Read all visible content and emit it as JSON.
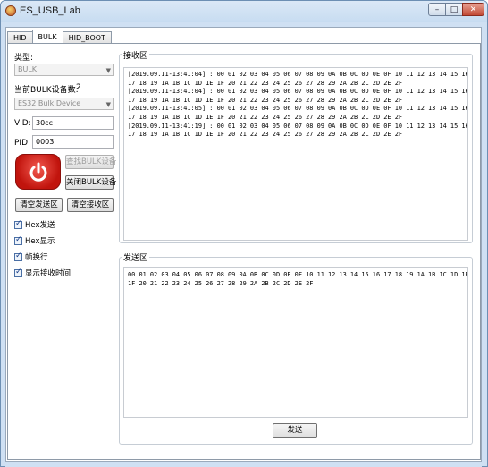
{
  "window": {
    "title": "ES_USB_Lab",
    "controls": {
      "minimize": "–",
      "maximize": "□",
      "close": "✕"
    }
  },
  "tabs": [
    {
      "label": "HID"
    },
    {
      "label": "BULK"
    },
    {
      "label": "HID_BOOT"
    }
  ],
  "left": {
    "type_label": "类型:",
    "type_value": "BULK",
    "device_count_label": "当前BULK设备数:",
    "device_count": "2",
    "device_value": "ES32 Bulk Device",
    "vid_label": "VID:",
    "vid_value": "30cc",
    "pid_label": "PID:",
    "pid_value": "0003",
    "find_button": "查找BULK设备",
    "close_button": "关闭BULK设备",
    "clear_send_button": "清空发送区",
    "clear_recv_button": "清空接收区",
    "checkboxes": [
      {
        "label": "Hex发送",
        "checked": true
      },
      {
        "label": "Hex显示",
        "checked": true
      },
      {
        "label": "帧换行",
        "checked": true
      },
      {
        "label": "显示接收时间",
        "checked": true
      }
    ]
  },
  "receive": {
    "title": "接收区",
    "text": "[2019.09.11-13:41:04] : 00 01 02 03 04 05 06 07 08 09 0A 0B 0C 0D 0E 0F 10 11 12 13 14 15 16\n17 18 19 1A 1B 1C 1D 1E 1F 20 21 22 23 24 25 26 27 28 29 2A 2B 2C 2D 2E 2F\n[2019.09.11-13:41:04] : 00 01 02 03 04 05 06 07 08 09 0A 0B 0C 0D 0E 0F 10 11 12 13 14 15 16\n17 18 19 1A 1B 1C 1D 1E 1F 20 21 22 23 24 25 26 27 28 29 2A 2B 2C 2D 2E 2F\n[2019.09.11-13:41:05] : 00 01 02 03 04 05 06 07 08 09 0A 0B 0C 0D 0E 0F 10 11 12 13 14 15 16\n17 18 19 1A 1B 1C 1D 1E 1F 20 21 22 23 24 25 26 27 28 29 2A 2B 2C 2D 2E 2F\n[2019.09.11-13:41:19] : 00 01 02 03 04 05 06 07 08 09 0A 0B 0C 0D 0E 0F 10 11 12 13 14 15 16\n17 18 19 1A 1B 1C 1D 1E 1F 20 21 22 23 24 25 26 27 28 29 2A 2B 2C 2D 2E 2F"
  },
  "send": {
    "title": "发送区",
    "text": "00 01 02 03 04 05 06 07 08 09 0A 0B 0C 0D 0E 0F 10 11 12 13 14 15 16 17 18 19 1A 1B 1C 1D 1E\n1F 20 21 22 23 24 25 26 27 28 29 2A 2B 2C 2D 2E 2F",
    "button": "发送"
  },
  "colors": {
    "titlebar": "#cfe0f3",
    "power_button": "#d51f17",
    "close_button": "#c24a35"
  }
}
